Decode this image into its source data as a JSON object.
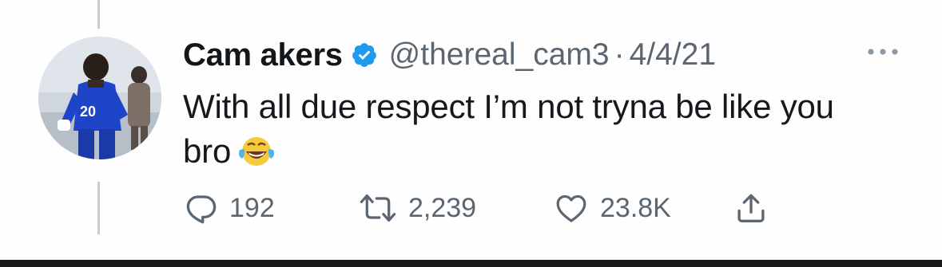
{
  "tweet": {
    "display_name": "Cam akers",
    "handle": "@thereal_cam3",
    "separator": "·",
    "date": "4/4/21",
    "text_line1": "With all due respect I’m not tryna be like you",
    "text_line2": "bro",
    "emoji": "face-with-tears-of-joy",
    "verified": true
  },
  "actions": {
    "reply_count": "192",
    "retweet_count": "2,239",
    "like_count": "23.8K"
  },
  "colors": {
    "verified_blue": "#1d9bf0",
    "secondary_text": "#5b6670",
    "primary_text": "#14171a",
    "thread_line": "#c9cdd1"
  },
  "icons": {
    "more": "more-horizontal-icon",
    "reply": "reply-bubble-icon",
    "retweet": "retweet-icon",
    "like": "heart-icon",
    "share": "share-upload-icon"
  }
}
